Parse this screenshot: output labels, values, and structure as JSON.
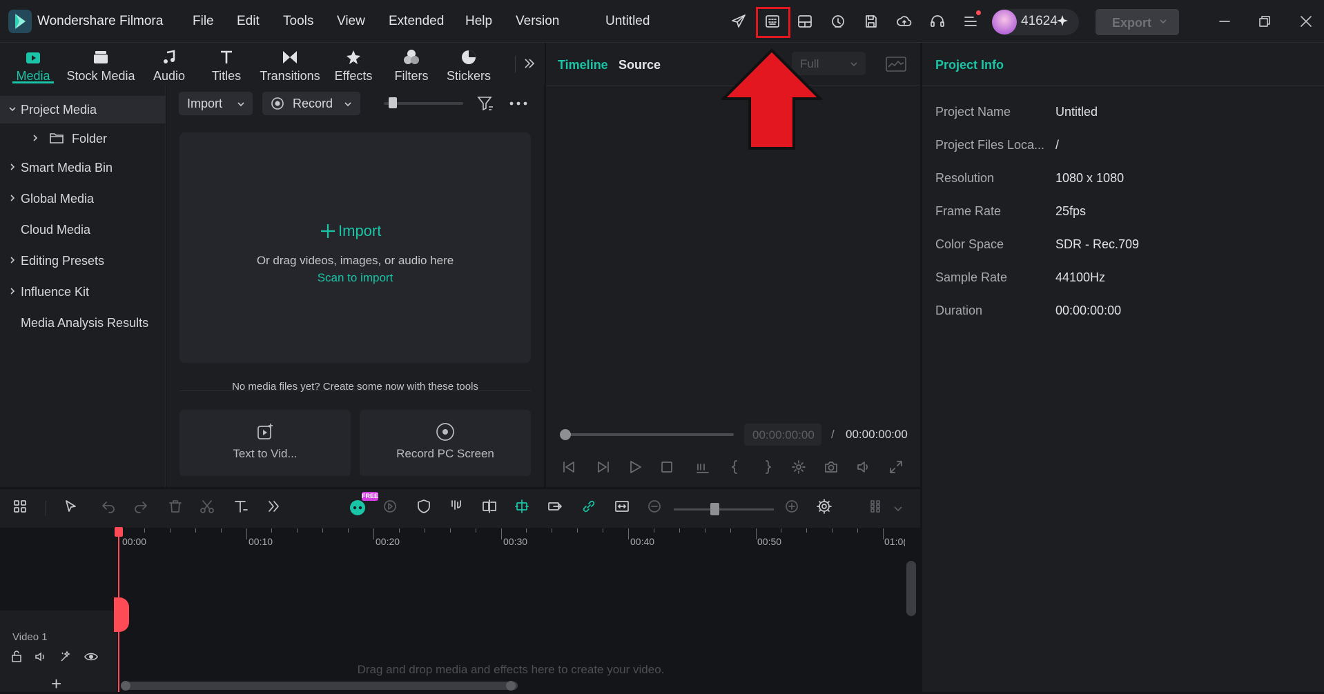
{
  "app": {
    "name": "Wondershare Filmora",
    "document_title": "Untitled"
  },
  "menu": [
    "File",
    "Edit",
    "Tools",
    "View",
    "Extended",
    "Help",
    "Version"
  ],
  "account": {
    "credits": "41624"
  },
  "export_button": "Export",
  "media_tabs": [
    "Media",
    "Stock Media",
    "Audio",
    "Titles",
    "Transitions",
    "Effects",
    "Filters",
    "Stickers"
  ],
  "sidebar": {
    "items": [
      {
        "label": "Project Media"
      },
      {
        "label": "Folder"
      },
      {
        "label": "Smart Media Bin"
      },
      {
        "label": "Global Media"
      },
      {
        "label": "Cloud Media"
      },
      {
        "label": "Editing Presets"
      },
      {
        "label": "Influence Kit"
      },
      {
        "label": "Media Analysis Results"
      }
    ]
  },
  "media_toolbar": {
    "import_label": "Import",
    "record_label": "Record"
  },
  "dropzone": {
    "import_label": "Import",
    "drag_text": "Or drag videos, images, or audio here",
    "scan_text": "Scan to import"
  },
  "no_media_text": "No media files yet? Create some now with these tools",
  "tools": [
    {
      "label": "Text to Vid..."
    },
    {
      "label": "Record PC Screen"
    }
  ],
  "player": {
    "tab_timeline": "Timeline",
    "tab_source": "Source",
    "quality": "Full",
    "current_time": "00:00:00:00",
    "separator": "/",
    "duration": "00:00:00:00"
  },
  "project_info": {
    "title": "Project Info",
    "rows": [
      {
        "label": "Project Name",
        "value": "Untitled"
      },
      {
        "label": "Project Files Loca...",
        "value": "/"
      },
      {
        "label": "Resolution",
        "value": "1080 x 1080"
      },
      {
        "label": "Frame Rate",
        "value": "25fps"
      },
      {
        "label": "Color Space",
        "value": "SDR - Rec.709"
      },
      {
        "label": "Sample Rate",
        "value": "44100Hz"
      },
      {
        "label": "Duration",
        "value": "00:00:00:00"
      }
    ]
  },
  "timeline": {
    "free_badge": "FREE",
    "ruler": [
      "00:00",
      "00:10",
      "00:20",
      "00:30",
      "00:40",
      "00:50",
      "01:0("
    ],
    "track_label": "Video 1",
    "empty_text": "Drag and drop media and effects here to create your video.",
    "add_track": "+"
  },
  "colors": {
    "accent": "#19c5a6",
    "highlight": "#e3171f",
    "playhead": "#ff4b55"
  }
}
